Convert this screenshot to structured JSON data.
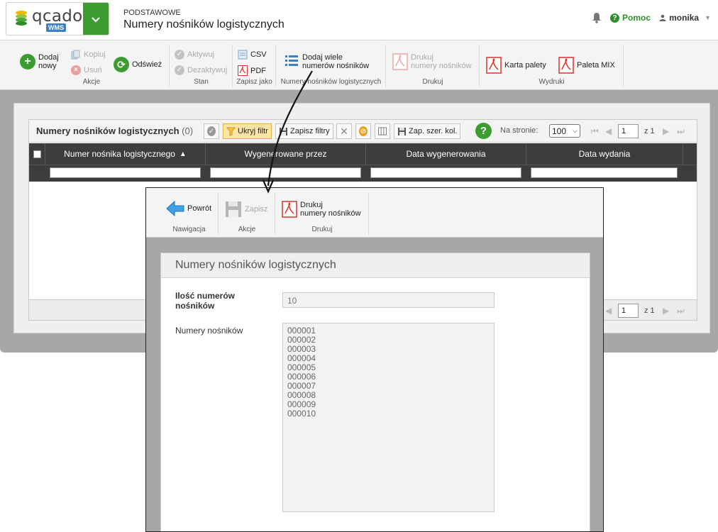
{
  "header": {
    "logo_text": "qcadoo",
    "logo_badge": "WMS",
    "section": "PODSTAWOWE",
    "title": "Numery nośników logistycznych",
    "help_label": "Pomoc",
    "user_name": "monika"
  },
  "ribbon": {
    "groups": {
      "akcje": "Akcje",
      "stan": "Stan",
      "zapisz_jako": "Zapisz jako",
      "numery": "Numery nośników logistycznych",
      "drukuj": "Drukuj",
      "wydruki": "Wydruki"
    },
    "buttons": {
      "dodaj_line1": "Dodaj",
      "dodaj_line2": "nowy",
      "kopiuj": "Kopiuj",
      "usun": "Usuń",
      "odswiez": "Odśwież",
      "aktywuj": "Aktywuj",
      "dezaktywuj": "Dezaktywuj",
      "csv": "CSV",
      "pdf": "PDF",
      "dodaj_wiele_line1": "Dodaj wiele",
      "dodaj_wiele_line2": "numerów nośników",
      "drukuj_line1": "Drukuj",
      "drukuj_line2": "numery nośników",
      "karta_palety": "Karta palety",
      "paleta_mix": "Paleta MIX"
    }
  },
  "grid": {
    "title": "Numery nośników logistycznych",
    "count": "(0)",
    "buttons": {
      "ukryj_filtr": "Ukryj filtr",
      "zapisz_filtry": "Zapisz filtry",
      "zap_szer_kol": "Zap. szer. kol."
    },
    "per_page_label": "Na stronie:",
    "per_page_value": "100",
    "page_value": "1",
    "page_of": "z 1",
    "columns": [
      "Numer nośnika logistycznego",
      "Wygenerowane przez",
      "Data wygenerowania",
      "Data wydania"
    ]
  },
  "modal": {
    "ribbon": {
      "groups": {
        "nawigacja": "Nawigacja",
        "akcje": "Akcje",
        "drukuj": "Drukuj"
      },
      "buttons": {
        "powrot": "Powrót",
        "zapisz": "Zapisz",
        "drukuj_line1": "Drukuj",
        "drukuj_line2": "numery nośników"
      }
    },
    "form_title": "Numery nośników logistycznych",
    "fields": {
      "ilosc_label_line1": "Ilość numerów",
      "ilosc_label_line2": "nośników",
      "ilosc_value": "10",
      "numery_label": "Numery nośników",
      "numery_values": [
        "000001",
        "000002",
        "000003",
        "000004",
        "000005",
        "000006",
        "000007",
        "000008",
        "000009",
        "000010"
      ]
    }
  },
  "colors": {
    "brand_green": "#3c9c2f",
    "help_green": "#2f8f2f",
    "grid_header": "#3d3d3d",
    "pdf_red": "#d9342b"
  }
}
